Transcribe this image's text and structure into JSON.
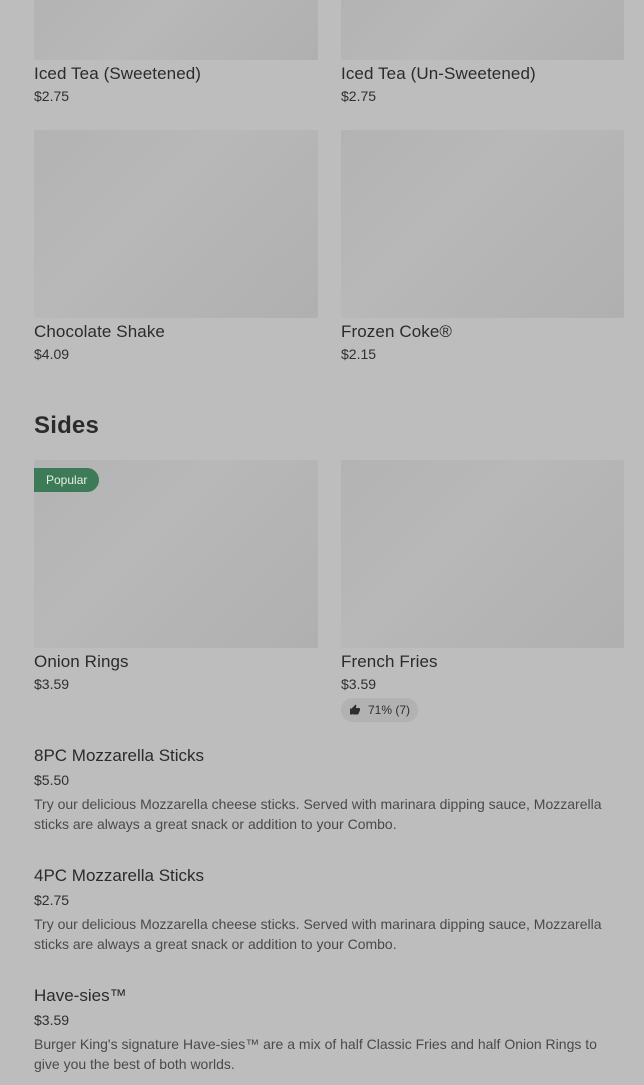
{
  "drinks": [
    {
      "name": "Iced Tea (Sweetened)",
      "price": "$2.75"
    },
    {
      "name": "Iced Tea (Un-Sweetened)",
      "price": "$2.75"
    },
    {
      "name": "Chocolate Shake",
      "price": "$4.09"
    },
    {
      "name": "Frozen Coke®",
      "price": "$2.15"
    }
  ],
  "sides": {
    "title": "Sides",
    "cards": [
      {
        "name": "Onion Rings",
        "price": "$3.59",
        "badge": "Popular"
      },
      {
        "name": "French Fries",
        "price": "$3.59",
        "rating": "71% (7)",
        "rating_icon": "thumbs-up-icon"
      }
    ],
    "list": [
      {
        "name": "8PC Mozzarella Sticks",
        "price": "$5.50",
        "description": "Try our delicious Mozzarella cheese sticks. Served with marinara dipping sauce, Mozzarella sticks are always a great snack or addition to your Combo."
      },
      {
        "name": "4PC Mozzarella Sticks",
        "price": "$2.75",
        "description": "Try our delicious Mozzarella cheese sticks. Served with marinara dipping sauce, Mozzarella sticks are always a great snack or addition to your Combo."
      },
      {
        "name": "Have-sies™",
        "price": "$3.59",
        "description": "Burger King's signature Have-sies™ are a mix of half Classic Fries and half Onion Rings to give you the best of both worlds."
      }
    ]
  },
  "colors": {
    "overlay_background": "#bdbdbd",
    "popular_badge": "#3d7a57",
    "text_primary": "#2b2b2b"
  }
}
